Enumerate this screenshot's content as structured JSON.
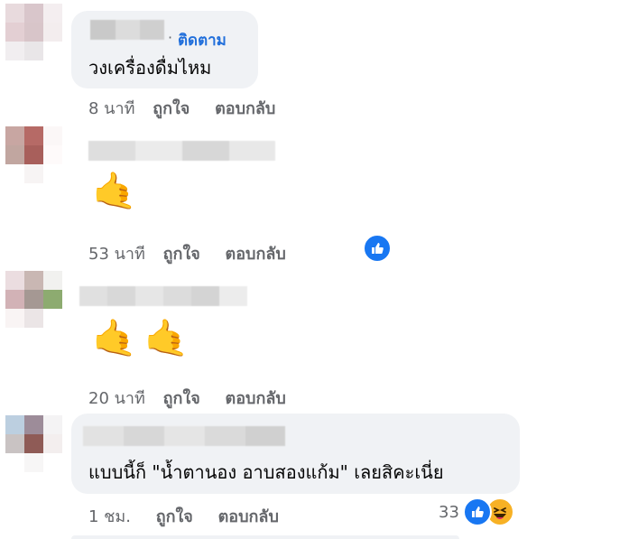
{
  "comments": [
    {
      "follow_label": "ติดตาม",
      "text": "วงเครื่องดื่มไหม",
      "time": "8 นาที",
      "like_label": "ถูกใจ",
      "reply_label": "ตอบกลับ"
    },
    {
      "emoji": "🤙",
      "time": "53 นาที",
      "like_label": "ถูกใจ",
      "reply_label": "ตอบกลับ",
      "reaction_icon": "like-icon"
    },
    {
      "emoji": "🤙🤙",
      "time": "20 นาที",
      "like_label": "ถูกใจ",
      "reply_label": "ตอบกลับ"
    },
    {
      "text": "แบบนี้ก็ \"น้ำตานอง อาบสองแก้ม\" เลยสิคะเนี่ย",
      "time": "1 ชม.",
      "like_label": "ถูกใจ",
      "reply_label": "ตอบกลับ",
      "reaction_count": "33",
      "reaction_icons": [
        "like-icon",
        "haha-icon"
      ]
    }
  ],
  "colors": {
    "bubble_bg": "#f0f2f5",
    "follow_link": "#216fdb",
    "meta_text": "#65676b",
    "like_blue": "#1877f2",
    "haha_yellow": "#f7b125"
  }
}
